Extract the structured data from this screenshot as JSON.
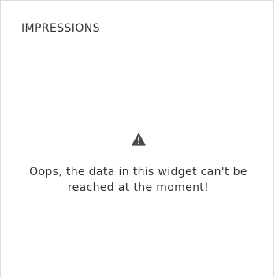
{
  "widget": {
    "title": "IMPRESSIONS",
    "status_icon": "warning-icon",
    "error_line_1": "Oops, the data in this widget can't be",
    "error_line_2": "reached at the moment!"
  },
  "colors": {
    "icon": "#4a4a4a",
    "text": "#2e2e2e",
    "border": "#dcdcdc"
  }
}
